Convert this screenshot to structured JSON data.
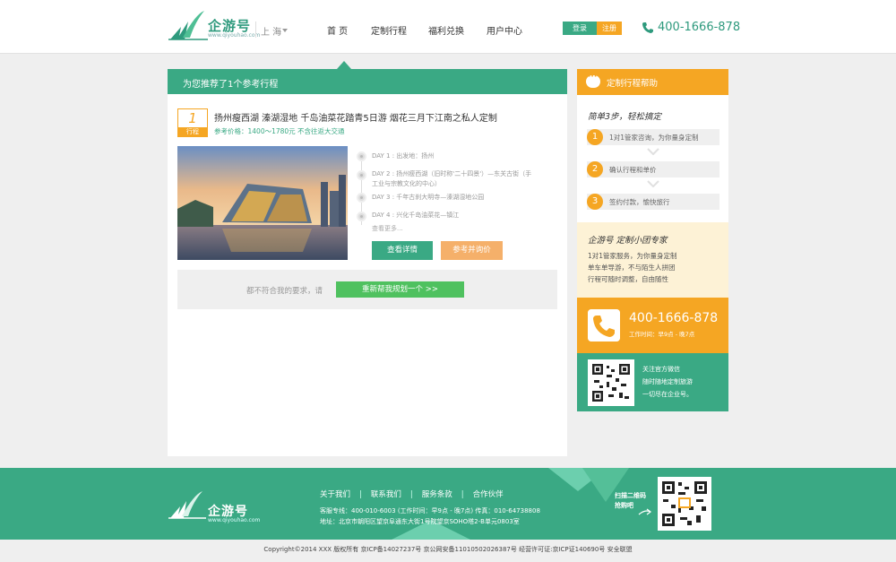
{
  "header": {
    "logo_text": "企游号",
    "logo_sub": "www.qiyouhao.com",
    "city": "上 海",
    "nav": [
      "首 页",
      "定制行程",
      "福利兑换",
      "用户中心"
    ],
    "login": "登录",
    "register": "注册",
    "phone": "400-1666-878"
  },
  "main": {
    "bar_title": "为您推荐了1个参考行程",
    "trip": {
      "number": "1",
      "number_label": "行程",
      "title": "扬州瘦西湖 溱湖湿地 千岛油菜花踏青5日游 烟花三月下江南之私人定制",
      "price": "参考价格：1400～1780元 不含往返大交通",
      "days": [
        "DAY 1 :  出发地：扬州",
        "DAY 2 :  扬州瘦西湖（旧时称'二十四景'）—东关古街（手工业与宗教文化的中心）",
        "DAY 3 :  千年古刹大明寺—溱湖湿地公园",
        "DAY 4 :  兴化千岛油菜花—镇江"
      ],
      "more": "查看更多...",
      "detail_btn": "查看详情",
      "consult_btn": "参考并询价"
    },
    "replan_text": "都不符合我的要求，请",
    "replan_btn": "重新帮我规划一个   >>"
  },
  "sidebar": {
    "help_title": "定制行程帮助",
    "steps_title": "简单3步，轻松搞定",
    "steps": [
      {
        "num": "1",
        "text": "1对1管家咨询，为你量身定制"
      },
      {
        "num": "2",
        "text": "确认行程和单价"
      },
      {
        "num": "3",
        "text": "签约付款，愉快旅行"
      }
    ],
    "expert_title": "企游号 定制小团专家",
    "expert_lines": [
      "1对1管家服务，为你量身定制",
      "单车单导游，不与陌生人拼团",
      "行程可随时调整，自由随性"
    ],
    "tel": "400-1666-878",
    "tel_time": "工作时间：早9点 - 晚7点",
    "wechat_lines": [
      "关注官方微信",
      "随时随地定制旅游",
      "一切尽在企业号。"
    ]
  },
  "footer": {
    "logo_text": "企游号",
    "logo_sub": "www.qiyouhao.com",
    "links": [
      "关于我们",
      "联系我们",
      "服务条款",
      "合作伙伴"
    ],
    "hotline": "客服专线：400-010-6003 (工作时间：早9点 - 晚7点)  传真：010-64738808",
    "address": "地址：北京市朝阳区望京阜通东大街1号院望京SOHO塔2-B单元0803室",
    "scan_line1": "扫描二维码",
    "scan_line2": "抢购吧",
    "copyright": "Copyright©2014   XXX   版权所有   京ICP备14027237号   京公网安备11010502026387号   经营许可证:京ICP证140690号   安全联盟"
  },
  "colors": {
    "green": "#3aa984",
    "orange": "#f5a623",
    "light_green_btn": "#4fc15f"
  }
}
